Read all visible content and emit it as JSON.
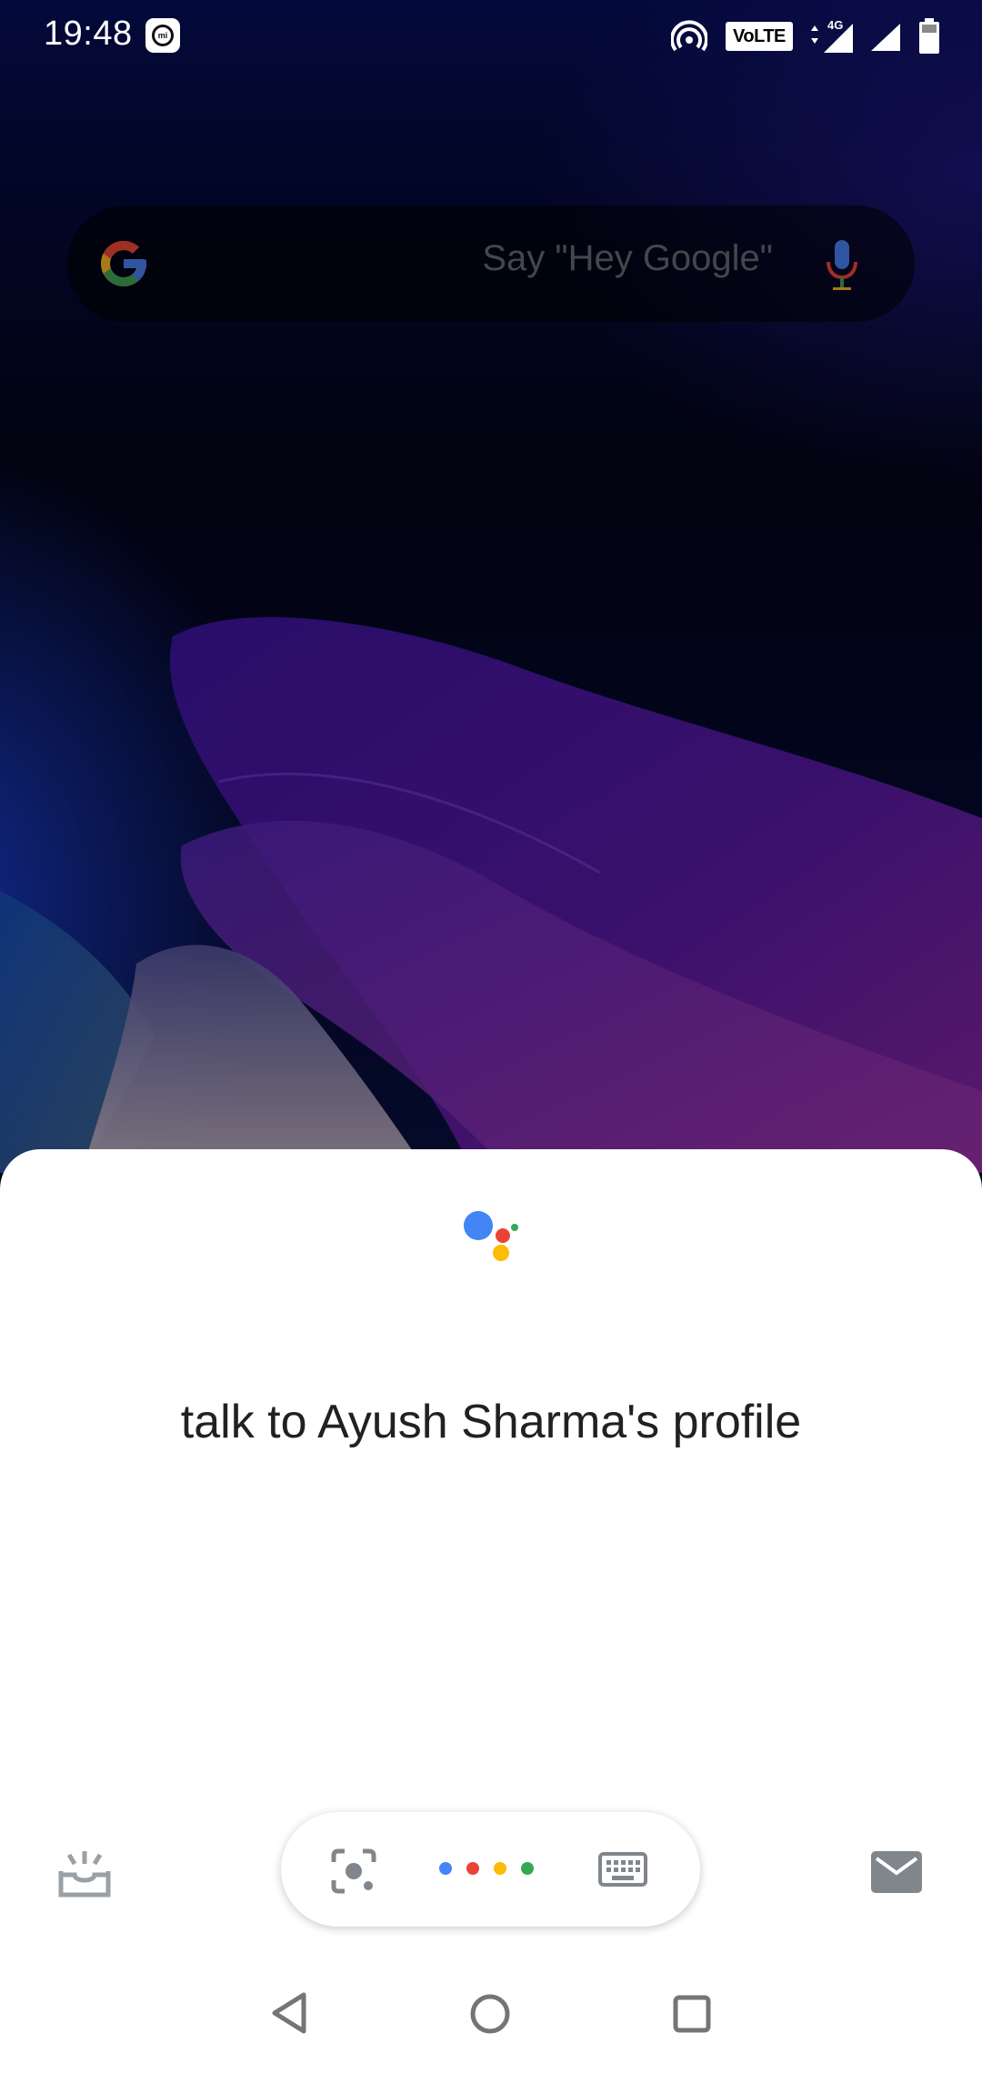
{
  "status_bar": {
    "time": "19:48",
    "volte_label": "VoLTE",
    "network_label": "4G",
    "icons": [
      "mi-icon",
      "hotspot-icon",
      "signal-4g-icon",
      "signal-icon",
      "battery-icon"
    ]
  },
  "search_bar": {
    "hint": "Say \"Hey Google\"",
    "icons": [
      "google-g-icon",
      "mic-icon"
    ]
  },
  "assistant": {
    "query": "talk to Ayush Sharma's profile",
    "icons": [
      "assistant-logo-icon",
      "updates-icon",
      "lens-icon",
      "keyboard-icon",
      "inbox-icon"
    ]
  },
  "navigation": {
    "icons": [
      "back-icon",
      "home-icon",
      "recents-icon"
    ]
  },
  "colors": {
    "google_blue": "#4285F4",
    "google_red": "#EA4335",
    "google_yellow": "#FBBC05",
    "google_green": "#34A853",
    "icon_gray": "#9aa0a6",
    "sheet_background": "#ffffff",
    "query_text": "#202124"
  }
}
